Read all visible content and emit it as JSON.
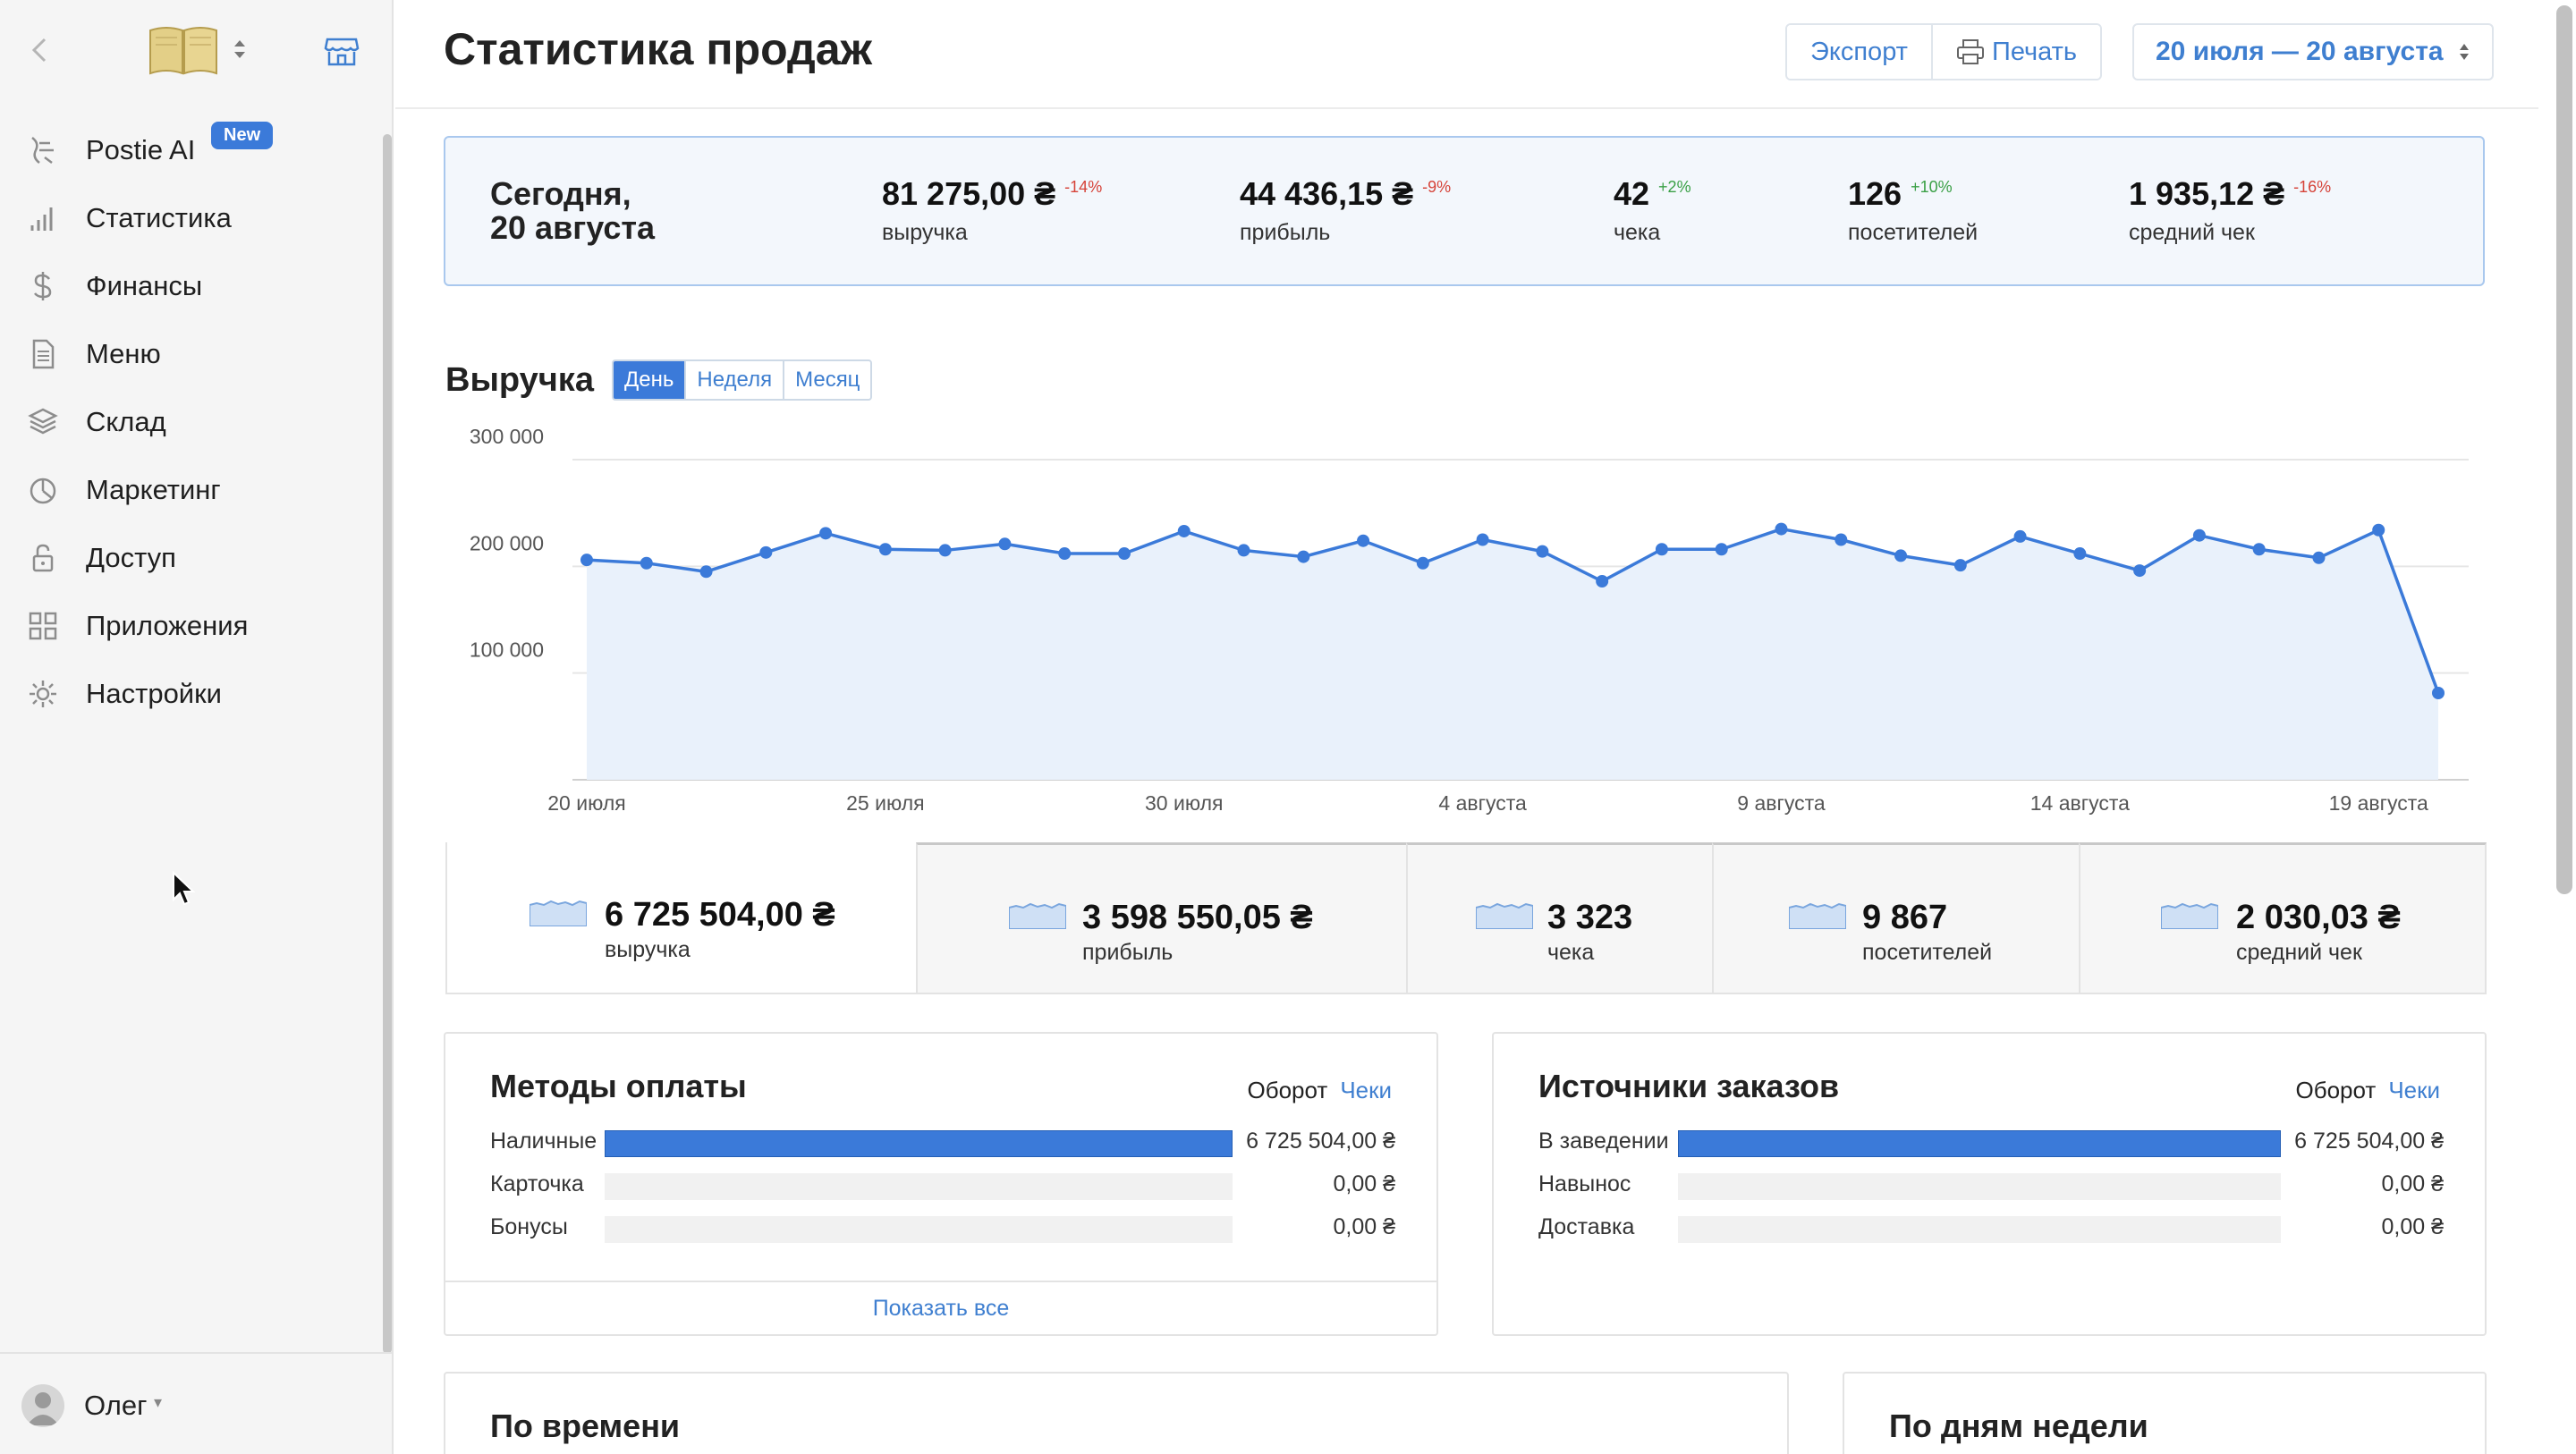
{
  "sidebar": {
    "badge": "New",
    "items": [
      {
        "label": "Postie AI",
        "icon": "postie-ai-icon"
      },
      {
        "label": "Статистика",
        "icon": "bar-chart-icon"
      },
      {
        "label": "Финансы",
        "icon": "dollar-icon"
      },
      {
        "label": "Меню",
        "icon": "document-icon"
      },
      {
        "label": "Склад",
        "icon": "layers-icon"
      },
      {
        "label": "Маркетинг",
        "icon": "pie-icon"
      },
      {
        "label": "Доступ",
        "icon": "lock-icon"
      },
      {
        "label": "Приложения",
        "icon": "grid-icon"
      },
      {
        "label": "Настройки",
        "icon": "gear-icon"
      }
    ],
    "user": "Олег"
  },
  "header": {
    "title": "Статистика продаж",
    "export_label": "Экспорт",
    "print_label": "Печать",
    "date_range": "20 июля — 20 августа"
  },
  "today": {
    "date_line1": "Сегодня,",
    "date_line2": "20 августа",
    "stats": [
      {
        "value": "81 275,00 ₴",
        "delta": "-14%",
        "label": "выручка",
        "trend": "down"
      },
      {
        "value": "44 436,15 ₴",
        "delta": "-9%",
        "label": "прибыль",
        "trend": "down"
      },
      {
        "value": "42",
        "delta": "+2%",
        "label": "чека",
        "trend": "up"
      },
      {
        "value": "126",
        "delta": "+10%",
        "label": "посетителей",
        "trend": "up"
      },
      {
        "value": "1 935,12 ₴",
        "delta": "-16%",
        "label": "средний чек",
        "trend": "down"
      }
    ]
  },
  "revenue": {
    "title": "Выручка",
    "tabs": [
      "День",
      "Неделя",
      "Месяц"
    ],
    "active_tab": "День"
  },
  "chart_data": {
    "type": "area",
    "x_tick_labels": [
      "20 июля",
      "25 июля",
      "30 июля",
      "4 августа",
      "9 августа",
      "14 августа",
      "19 августа"
    ],
    "y_tick_labels": [
      "300 000",
      "200 000",
      "100 000"
    ],
    "ylim": [
      0,
      300000
    ],
    "y_ticks": [
      100000,
      200000,
      300000
    ],
    "x_day_count": 32,
    "x_tick_every": 5,
    "values": [
      206000,
      203000,
      195000,
      213000,
      231000,
      216000,
      215000,
      221000,
      212000,
      212000,
      233000,
      215000,
      209000,
      224000,
      203000,
      225000,
      214000,
      186000,
      216000,
      216000,
      235000,
      225000,
      210000,
      201000,
      228000,
      212000,
      196000,
      229000,
      216000,
      208000,
      234000,
      81275
    ],
    "grid": true,
    "color": "#3b7ad9",
    "fill": "#e9f1fb"
  },
  "totals": [
    {
      "value": "6 725 504,00 ₴",
      "label": "выручка"
    },
    {
      "value": "3 598 550,05 ₴",
      "label": "прибыль"
    },
    {
      "value": "3 323",
      "label": "чека"
    },
    {
      "value": "9 867",
      "label": "посетителей"
    },
    {
      "value": "2 030,03 ₴",
      "label": "средний чек"
    }
  ],
  "payment_methods": {
    "title": "Методы оплаты",
    "toggle_a": "Оборот",
    "toggle_b": "Чеки",
    "rows": [
      {
        "label": "Наличные",
        "value": "6 725 504,00 ₴",
        "share": 1.0
      },
      {
        "label": "Карточка",
        "value": "0,00 ₴",
        "share": 0
      },
      {
        "label": "Бонусы",
        "value": "0,00 ₴",
        "share": 0
      }
    ],
    "show_all": "Показать все"
  },
  "order_sources": {
    "title": "Источники заказов",
    "toggle_a": "Оборот",
    "toggle_b": "Чеки",
    "rows": [
      {
        "label": "В заведении",
        "value": "6 725 504,00 ₴",
        "share": 1.0
      },
      {
        "label": "Навынос",
        "value": "0,00 ₴",
        "share": 0
      },
      {
        "label": "Доставка",
        "value": "0,00 ₴",
        "share": 0
      }
    ]
  },
  "by_time": {
    "title": "По времени"
  },
  "by_weekday": {
    "title": "По дням недели"
  }
}
